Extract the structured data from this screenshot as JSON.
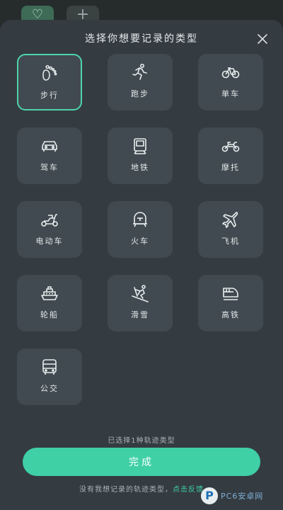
{
  "background": {
    "btn1_glyph": "♡",
    "btn2_glyph": "+"
  },
  "sheet": {
    "title": "选择你想要记录的类型",
    "close_label": "×"
  },
  "types": [
    {
      "label": "步行",
      "icon": "footprint-icon",
      "selected": true
    },
    {
      "label": "跑步",
      "icon": "runner-icon",
      "selected": false
    },
    {
      "label": "单车",
      "icon": "bicycle-icon",
      "selected": false
    },
    {
      "label": "驾车",
      "icon": "car-icon",
      "selected": false
    },
    {
      "label": "地铁",
      "icon": "subway-icon",
      "selected": false
    },
    {
      "label": "摩托",
      "icon": "motorcycle-icon",
      "selected": false
    },
    {
      "label": "电动车",
      "icon": "scooter-icon",
      "selected": false
    },
    {
      "label": "火车",
      "icon": "train-icon",
      "selected": false
    },
    {
      "label": "飞机",
      "icon": "airplane-icon",
      "selected": false
    },
    {
      "label": "轮船",
      "icon": "ship-icon",
      "selected": false
    },
    {
      "label": "滑雪",
      "icon": "skiing-icon",
      "selected": false
    },
    {
      "label": "高铁",
      "icon": "highspeed-rail-icon",
      "selected": false
    },
    {
      "label": "公交",
      "icon": "bus-icon",
      "selected": false
    }
  ],
  "count_text": "已选择1种轨迹类型",
  "done_label": "完成",
  "footer": {
    "text": "没有我想记录的轨迹类型，",
    "link": "点击反馈"
  },
  "watermark": {
    "mark": "P",
    "text": "PC6安卓网"
  },
  "colors": {
    "accent": "#3fd0a6",
    "sheet": "#343b41",
    "tile": "#424a51"
  }
}
